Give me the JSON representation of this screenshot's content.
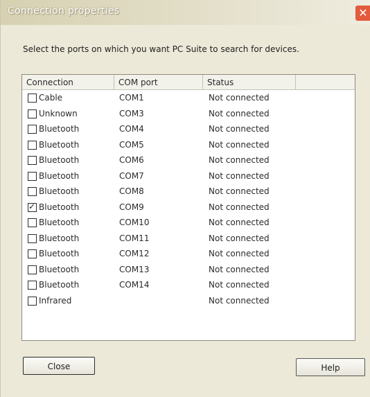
{
  "window": {
    "title": "Connection properties",
    "close_glyph": "✕"
  },
  "instructions": "Select the ports on which you want PC Suite to search for devices.",
  "table": {
    "columns": [
      "Connection",
      "COM port",
      "Status"
    ],
    "rows": [
      {
        "checked": false,
        "connection": "Cable",
        "port": "COM1",
        "status": "Not connected"
      },
      {
        "checked": false,
        "connection": "Unknown",
        "port": "COM3",
        "status": "Not connected"
      },
      {
        "checked": false,
        "connection": "Bluetooth",
        "port": "COM4",
        "status": "Not connected"
      },
      {
        "checked": false,
        "connection": "Bluetooth",
        "port": "COM5",
        "status": "Not connected"
      },
      {
        "checked": false,
        "connection": "Bluetooth",
        "port": "COM6",
        "status": "Not connected"
      },
      {
        "checked": false,
        "connection": "Bluetooth",
        "port": "COM7",
        "status": "Not connected"
      },
      {
        "checked": false,
        "connection": "Bluetooth",
        "port": "COM8",
        "status": "Not connected"
      },
      {
        "checked": true,
        "connection": "Bluetooth",
        "port": "COM9",
        "status": "Not connected"
      },
      {
        "checked": false,
        "connection": "Bluetooth",
        "port": "COM10",
        "status": "Not connected"
      },
      {
        "checked": false,
        "connection": "Bluetooth",
        "port": "COM11",
        "status": "Not connected"
      },
      {
        "checked": false,
        "connection": "Bluetooth",
        "port": "COM12",
        "status": "Not connected"
      },
      {
        "checked": false,
        "connection": "Bluetooth",
        "port": "COM13",
        "status": "Not connected"
      },
      {
        "checked": false,
        "connection": "Bluetooth",
        "port": "COM14",
        "status": "Not connected"
      },
      {
        "checked": false,
        "connection": "Infrared",
        "port": "",
        "status": "Not connected"
      }
    ]
  },
  "buttons": {
    "close": "Close",
    "help": "Help"
  },
  "icons": {
    "checkbox_checked": "✓"
  },
  "colors": {
    "dialog_bg": "#ece9d8",
    "title_close_bg": "#e35a3c",
    "list_bg": "#ffffff"
  }
}
